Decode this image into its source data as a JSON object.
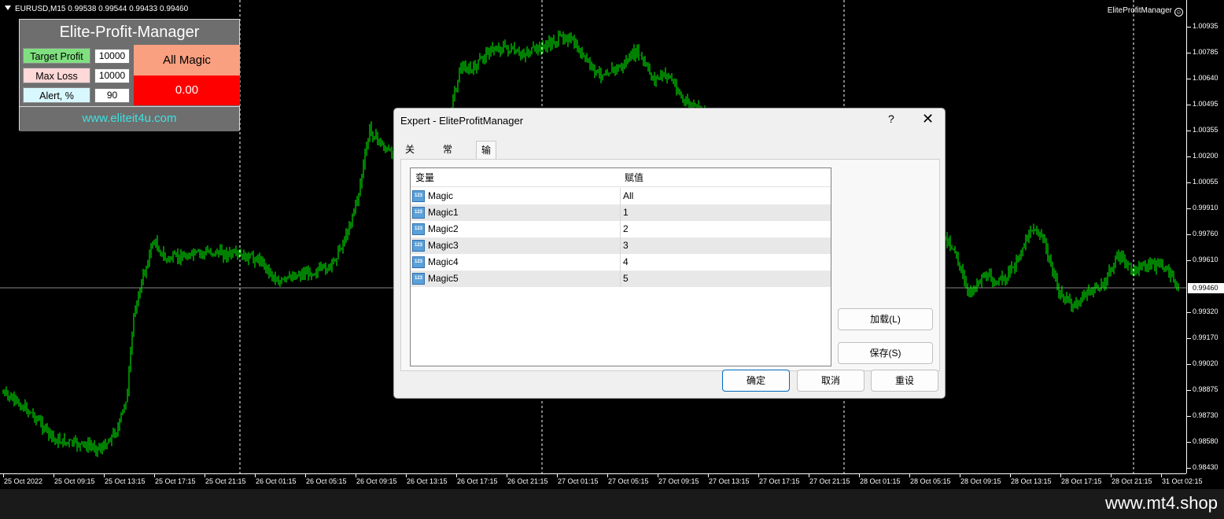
{
  "chart": {
    "symbol_line": "EURUSD,M15  0.99538 0.99544 0.99433 0.99460",
    "ea_label": "EliteProfitManager",
    "smile_icon": "☺",
    "current_price": "0.99460",
    "price_labels": [
      "1.00935",
      "1.00785",
      "1.00640",
      "1.00495",
      "1.00355",
      "1.00200",
      "1.00055",
      "0.99910",
      "0.99760",
      "0.99610",
      "0.99320",
      "0.99170",
      "0.99020",
      "0.98875",
      "0.98730",
      "0.98580",
      "0.98430"
    ],
    "time_labels": [
      "25 Oct 2022",
      "25 Oct 09:15",
      "25 Oct 13:15",
      "25 Oct 17:15",
      "25 Oct 21:15",
      "26 Oct 01:15",
      "26 Oct 05:15",
      "26 Oct 09:15",
      "26 Oct 13:15",
      "26 Oct 17:15",
      "26 Oct 21:15",
      "27 Oct 01:15",
      "27 Oct 05:15",
      "27 Oct 09:15",
      "27 Oct 13:15",
      "27 Oct 17:15",
      "27 Oct 21:15",
      "28 Oct 01:15",
      "28 Oct 05:15",
      "28 Oct 09:15",
      "28 Oct 13:15",
      "28 Oct 17:15",
      "28 Oct 21:15",
      "31 Oct 02:15"
    ],
    "candle_color": "#00ff00",
    "grid_color": "#ffffff"
  },
  "ea_panel": {
    "title": "Elite-Profit-Manager",
    "target_label": "Target Profit",
    "target_value": "10000",
    "maxloss_label": "Max Loss",
    "maxloss_value": "10000",
    "alert_label": "Alert, %",
    "alert_value": "90",
    "magic_label": "All Magic",
    "pl_value": "0.00",
    "url": "www.eliteit4u.com"
  },
  "dialog": {
    "title": "Expert - EliteProfitManager",
    "help": "?",
    "close": "✕",
    "tabs": [
      "关于",
      "常用",
      "输入参数"
    ],
    "active_tab": "输入参数",
    "col_variable": "变量",
    "col_value": "赋值",
    "icon_text": "123",
    "rows": [
      {
        "name": "Magic",
        "value": "All"
      },
      {
        "name": "Magic1",
        "value": "1"
      },
      {
        "name": "Magic2",
        "value": "2"
      },
      {
        "name": "Magic3",
        "value": "3"
      },
      {
        "name": "Magic4",
        "value": "4"
      },
      {
        "name": "Magic5",
        "value": "5"
      }
    ],
    "load_label": "加载(L)",
    "save_label": "保存(S)",
    "ok_label": "确定",
    "cancel_label": "取消",
    "reset_label": "重设"
  },
  "footer": {
    "watermark": "www.mt4.shop"
  }
}
